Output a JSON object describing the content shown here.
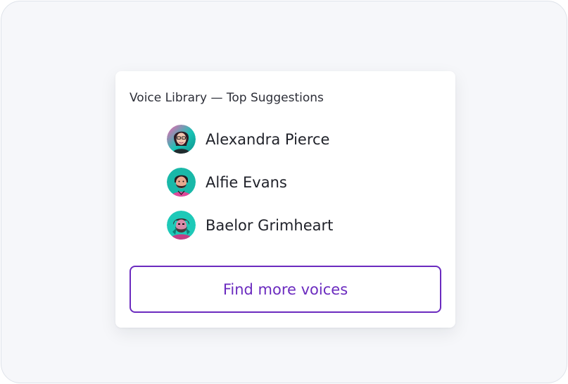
{
  "card": {
    "title": "Voice Library — Top Suggestions",
    "voices": [
      {
        "name": "Alexandra Pierce",
        "avatar_icon": "person-avatar-icon"
      },
      {
        "name": "Alfie Evans",
        "avatar_icon": "person-avatar-icon"
      },
      {
        "name": "Baelor Grimheart",
        "avatar_icon": "person-avatar-icon"
      }
    ],
    "find_more_label": "Find more voices"
  },
  "colors": {
    "accent": "#6b2bbf",
    "avatar_teal": "#19c3b5",
    "avatar_magenta": "#e0479a",
    "frame_bg": "#f6f7fa"
  }
}
